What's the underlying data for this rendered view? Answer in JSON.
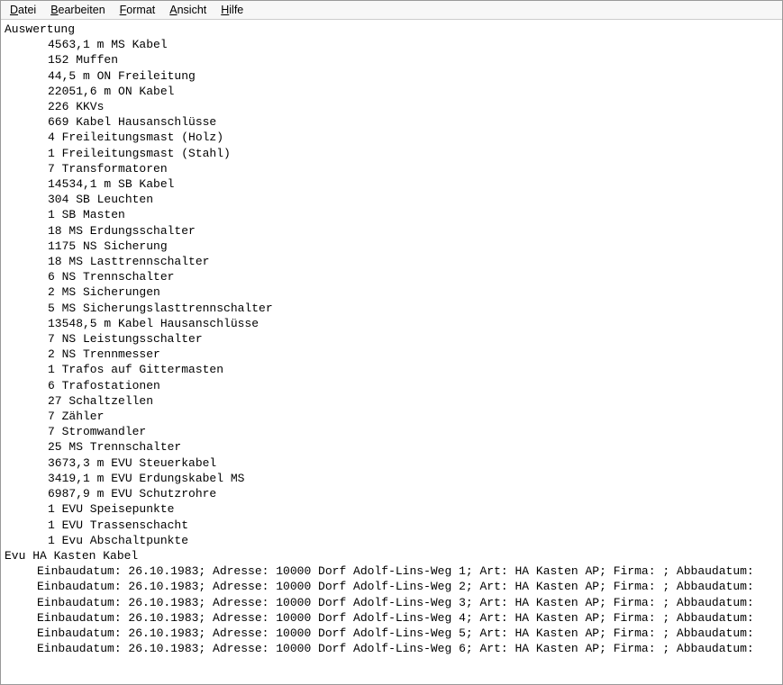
{
  "menu": {
    "items": [
      {
        "accel": "D",
        "rest": "atei"
      },
      {
        "accel": "B",
        "rest": "earbeiten"
      },
      {
        "accel": "F",
        "rest": "ormat"
      },
      {
        "accel": "A",
        "rest": "nsicht"
      },
      {
        "accel": "H",
        "rest": "ilfe"
      }
    ]
  },
  "body": {
    "heading": "Auswertung",
    "stats": [
      "4563,1 m MS Kabel",
      "152 Muffen",
      "44,5 m ON Freileitung",
      "22051,6 m ON Kabel",
      "226 KKVs",
      "669 Kabel Hausanschlüsse",
      "4 Freileitungsmast (Holz)",
      "1 Freileitungsmast (Stahl)",
      "7 Transformatoren",
      "14534,1 m SB Kabel",
      "304 SB Leuchten",
      "1 SB Masten",
      "18 MS Erdungsschalter",
      "1175 NS Sicherung",
      "18 MS Lasttrennschalter",
      "6 NS Trennschalter",
      "2 MS Sicherungen",
      "5 MS Sicherungslasttrennschalter",
      "13548,5 m Kabel Hausanschlüsse",
      "7 NS Leistungsschalter",
      "2 NS Trennmesser",
      "1 Trafos auf Gittermasten",
      "6 Trafostationen",
      "27 Schaltzellen",
      "7 Zähler",
      "7 Stromwandler",
      "25 MS Trennschalter",
      "3673,3 m EVU Steuerkabel",
      "3419,1 m EVU Erdungskabel MS",
      "6987,9 m EVU Schutzrohre",
      "1 EVU Speisepunkte",
      "1 EVU Trassenschacht",
      "1 Evu Abschaltpunkte"
    ],
    "section2": "Evu HA Kasten Kabel",
    "details": [
      "Einbaudatum: 26.10.1983; Adresse: 10000 Dorf Adolf-Lins-Weg 1; Art: HA Kasten AP; Firma: ; Abbaudatum:",
      "Einbaudatum: 26.10.1983; Adresse: 10000 Dorf Adolf-Lins-Weg 2; Art: HA Kasten AP; Firma: ; Abbaudatum:",
      "Einbaudatum: 26.10.1983; Adresse: 10000 Dorf Adolf-Lins-Weg 3; Art: HA Kasten AP; Firma: ; Abbaudatum:",
      "Einbaudatum: 26.10.1983; Adresse: 10000 Dorf Adolf-Lins-Weg 4; Art: HA Kasten AP; Firma: ; Abbaudatum:",
      "Einbaudatum: 26.10.1983; Adresse: 10000 Dorf Adolf-Lins-Weg 5; Art: HA Kasten AP; Firma: ; Abbaudatum:",
      "Einbaudatum: 26.10.1983; Adresse: 10000 Dorf Adolf-Lins-Weg 6; Art: HA Kasten AP; Firma: ; Abbaudatum:"
    ]
  }
}
